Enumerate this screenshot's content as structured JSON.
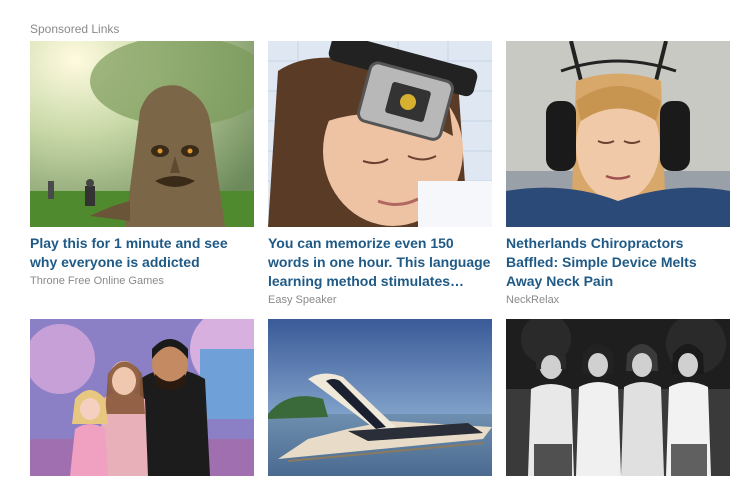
{
  "header": {
    "label": "Sponsored Links"
  },
  "cards": [
    {
      "image_alt": "tree-face-fantasy-game-image",
      "title": "Play this for 1 minute and see why everyone is addicted",
      "source": "Throne Free Online Games"
    },
    {
      "image_alt": "sleeping-woman-headband-device-image",
      "title": "You can memorize even 150 words in one hour. This language learning method stimulates…",
      "source": "Easy Speaker"
    },
    {
      "image_alt": "woman-neck-traction-device-image",
      "title": "Netherlands Chiropractors Baffled: Simple Device Melts Away Neck Pain",
      "source": "NeckRelax"
    },
    {
      "image_alt": "virtual-family-avatars-image",
      "title": "",
      "source": ""
    },
    {
      "image_alt": "futuristic-yacht-image",
      "title": "",
      "source": ""
    },
    {
      "image_alt": "four-women-black-and-white-photo",
      "title": "",
      "source": ""
    }
  ],
  "colors": {
    "link_title": "#1f5a86",
    "source_text": "#8a8a8a",
    "header_text": "#8a8a8a"
  }
}
